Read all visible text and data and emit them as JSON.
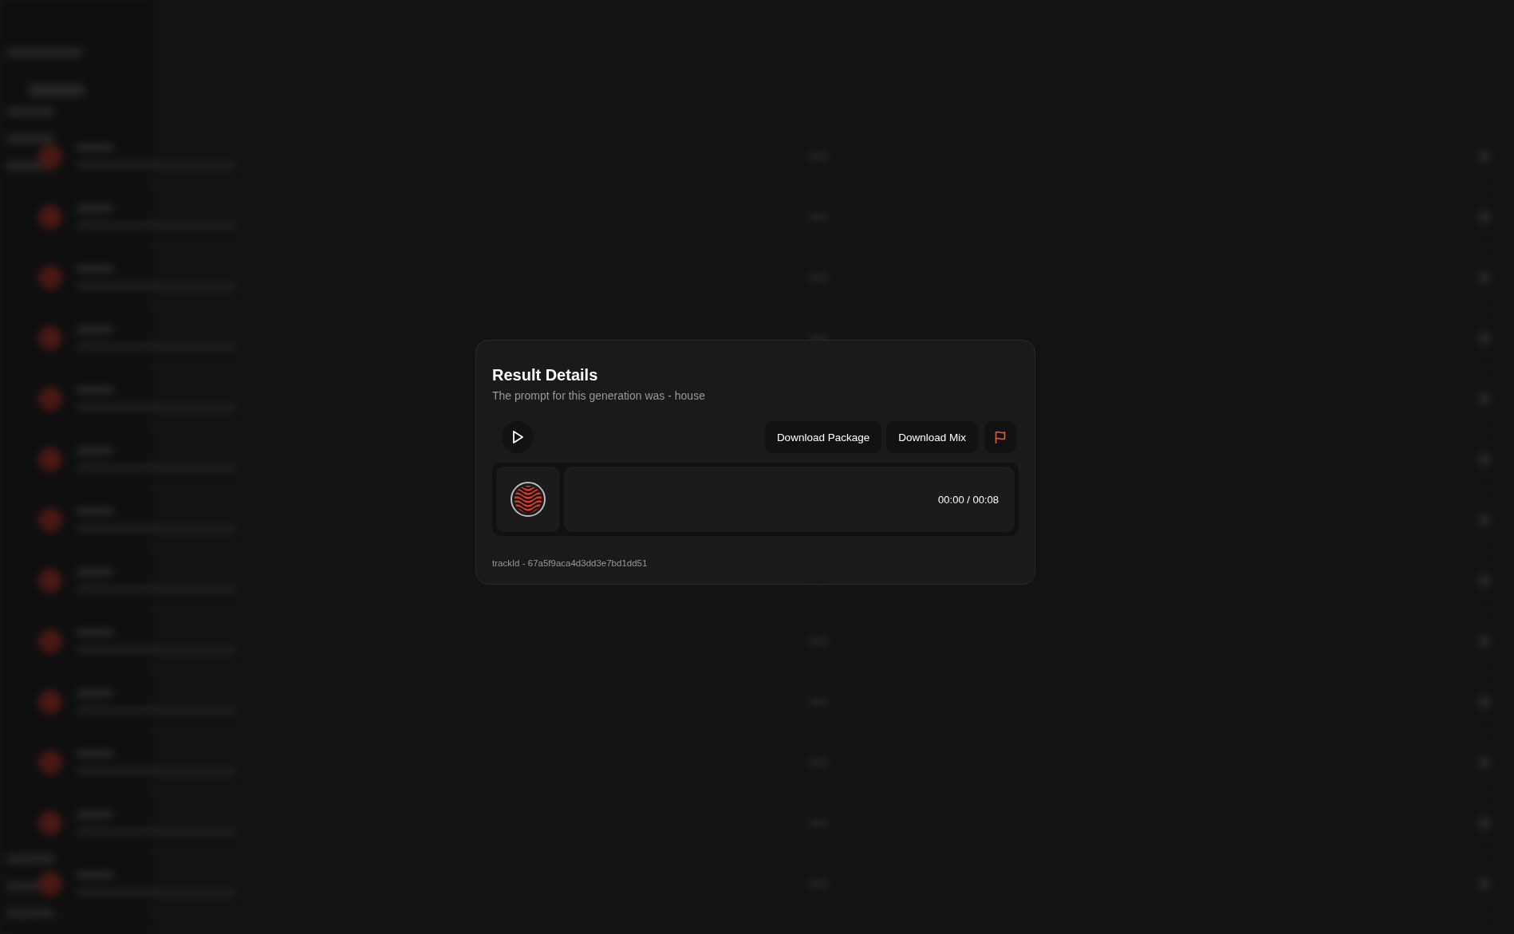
{
  "dialog": {
    "title": "Result Details",
    "subtitle": "The prompt for this generation was - house",
    "buttons": [
      {
        "label": "Download Package"
      },
      {
        "label": "Download Mix"
      }
    ],
    "player": {
      "time": "00:00 / 00:08",
      "playing": false
    },
    "track_id": "trackId - 67a5f9aca4d3dd3e7bd1dd51"
  }
}
